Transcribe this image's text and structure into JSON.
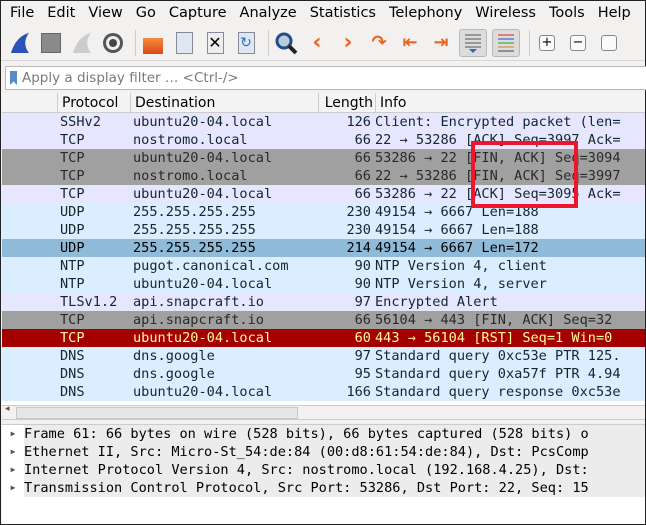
{
  "menu": [
    "File",
    "Edit",
    "View",
    "Go",
    "Capture",
    "Analyze",
    "Statistics",
    "Telephony",
    "Wireless",
    "Tools",
    "Help"
  ],
  "toolbar": [
    "start-capture",
    "stop-capture",
    "restart-capture",
    "capture-options",
    "open-file",
    "save-file",
    "close-file",
    "reload-file",
    "find-packet",
    "go-back",
    "go-forward",
    "go-to-packet",
    "go-first",
    "go-last",
    "auto-scroll",
    "colorize",
    "zoom-in",
    "zoom-out"
  ],
  "filter": {
    "placeholder": "Apply a display filter … <Ctrl-/>"
  },
  "columns": [
    "",
    "Protocol",
    "Destination",
    "Length",
    "Info"
  ],
  "colors": {
    "lavender": "#e7e6ff",
    "gray": "#a0a0a0",
    "udp": "#daeeff",
    "selected": "#8fbbd9",
    "rst_bg": "#a40000",
    "rst_fg": "#fffc9c",
    "highlight": "#f0142c"
  },
  "rows": [
    {
      "proto": "SSHv2",
      "dest": "ubuntu20-04.local",
      "len": "126",
      "info": "Client: Encrypted packet (len=",
      "style": "lavender"
    },
    {
      "proto": "TCP",
      "dest": "nostromo.local",
      "len": "66",
      "info": "22 → 53286 [ACK] Seq=3997 Ack=",
      "style": "lavender"
    },
    {
      "proto": "TCP",
      "dest": "ubuntu20-04.local",
      "len": "66",
      "info": "53286 → 22 [FIN, ACK] Seq=3094",
      "style": "gray"
    },
    {
      "proto": "TCP",
      "dest": "nostromo.local",
      "len": "66",
      "info": "22 → 53286 [FIN, ACK] Seq=3997",
      "style": "gray"
    },
    {
      "proto": "TCP",
      "dest": "ubuntu20-04.local",
      "len": "66",
      "info": "53286 → 22 [ACK] Seq=3095 Ack=",
      "style": "lavender"
    },
    {
      "proto": "UDP",
      "dest": "255.255.255.255",
      "len": "230",
      "info": "49154 → 6667 Len=188",
      "style": "udp"
    },
    {
      "proto": "UDP",
      "dest": "255.255.255.255",
      "len": "230",
      "info": "49154 → 6667 Len=188",
      "style": "udp"
    },
    {
      "proto": "UDP",
      "dest": "255.255.255.255",
      "len": "214",
      "info": "49154 → 6667 Len=172",
      "style": "selected"
    },
    {
      "proto": "NTP",
      "dest": "pugot.canonical.com",
      "len": "90",
      "info": "NTP Version 4, client",
      "style": "udp"
    },
    {
      "proto": "NTP",
      "dest": "ubuntu20-04.local",
      "len": "90",
      "info": "NTP Version 4, server",
      "style": "udp"
    },
    {
      "proto": "TLSv1.2",
      "dest": "api.snapcraft.io",
      "len": "97",
      "info": "Encrypted Alert",
      "style": "lavender"
    },
    {
      "proto": "TCP",
      "dest": "api.snapcraft.io",
      "len": "66",
      "info": "56104 → 443 [FIN, ACK] Seq=32",
      "style": "gray"
    },
    {
      "proto": "TCP",
      "dest": "ubuntu20-04.local",
      "len": "60",
      "info": "443 → 56104 [RST] Seq=1 Win=0",
      "style": "rst"
    },
    {
      "proto": "DNS",
      "dest": "dns.google",
      "len": "97",
      "info": "Standard query 0xc53e PTR 125.",
      "style": "udp"
    },
    {
      "proto": "DNS",
      "dest": "dns.google",
      "len": "95",
      "info": "Standard query 0xa57f PTR 4.94",
      "style": "udp"
    },
    {
      "proto": "DNS",
      "dest": "ubuntu20-04.local",
      "len": "166",
      "info": "Standard query response 0xc53e",
      "style": "udp"
    }
  ],
  "details": [
    "Frame 61: 66 bytes on wire (528 bits), 66 bytes captured (528 bits) o",
    "Ethernet II, Src: Micro-St_54:de:84 (00:d8:61:54:de:84), Dst: PcsComp",
    "Internet Protocol Version 4, Src: nostromo.local (192.168.4.25), Dst:",
    "Transmission Control Protocol, Src Port: 53286, Dst Port: 22, Seq: 15"
  ]
}
